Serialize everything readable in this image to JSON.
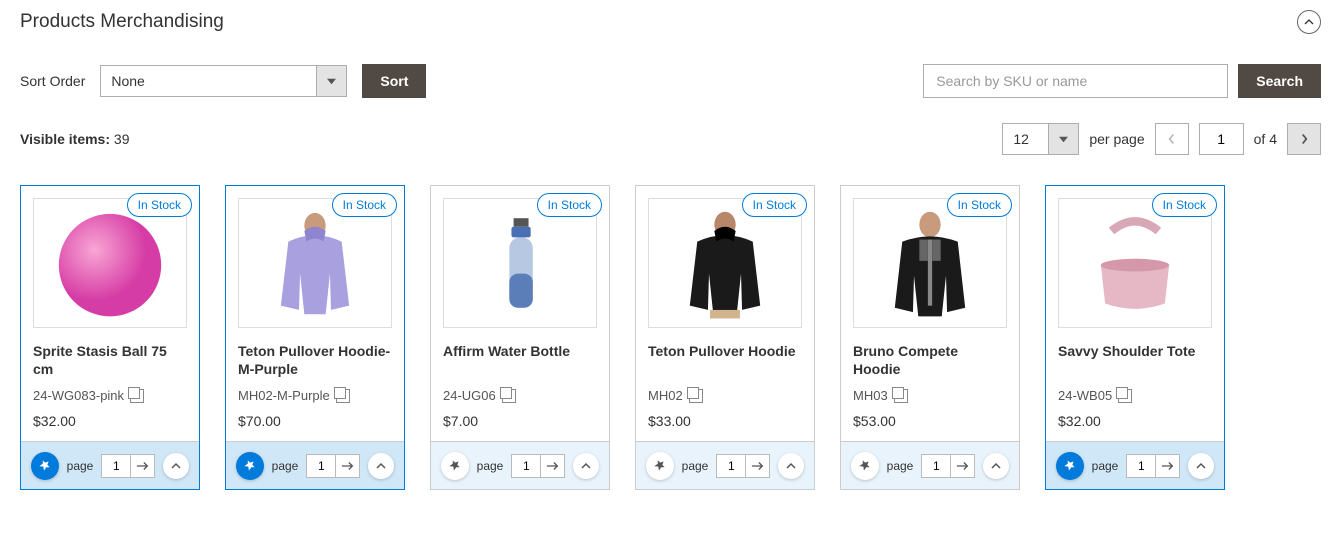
{
  "header": {
    "title": "Products Merchandising"
  },
  "toolbar": {
    "sort_label": "Sort Order",
    "sort_value": "None",
    "sort_button": "Sort",
    "search_placeholder": "Search by SKU or name",
    "search_button": "Search"
  },
  "pager": {
    "visible_label": "Visible items:",
    "visible_count": "39",
    "per_page_value": "12",
    "per_page_label": "per page",
    "current_page": "1",
    "of_label": "of 4"
  },
  "card_labels": {
    "page": "page",
    "page_value": "1"
  },
  "products": [
    {
      "name": "Sprite Stasis Ball 75 cm",
      "sku": "24-WG083-pink",
      "price": "$32.00",
      "stock": "In Stock",
      "pinned": true,
      "selected": true,
      "img": "ball"
    },
    {
      "name": "Teton Pullover Hoodie-M-Purple",
      "sku": "MH02-M-Purple",
      "price": "$70.00",
      "stock": "In Stock",
      "pinned": true,
      "selected": true,
      "img": "purple-hoodie"
    },
    {
      "name": "Affirm Water Bottle",
      "sku": "24-UG06",
      "price": "$7.00",
      "stock": "In Stock",
      "pinned": false,
      "selected": false,
      "img": "bottle"
    },
    {
      "name": "Teton Pullover Hoodie",
      "sku": "MH02",
      "price": "$33.00",
      "stock": "In Stock",
      "pinned": false,
      "selected": false,
      "img": "black-hoodie"
    },
    {
      "name": "Bruno Compete Hoodie",
      "sku": "MH03",
      "price": "$53.00",
      "stock": "In Stock",
      "pinned": false,
      "selected": false,
      "img": "zip-hoodie"
    },
    {
      "name": "Savvy Shoulder Tote",
      "sku": "24-WB05",
      "price": "$32.00",
      "stock": "In Stock",
      "pinned": true,
      "selected": true,
      "img": "tote"
    }
  ]
}
